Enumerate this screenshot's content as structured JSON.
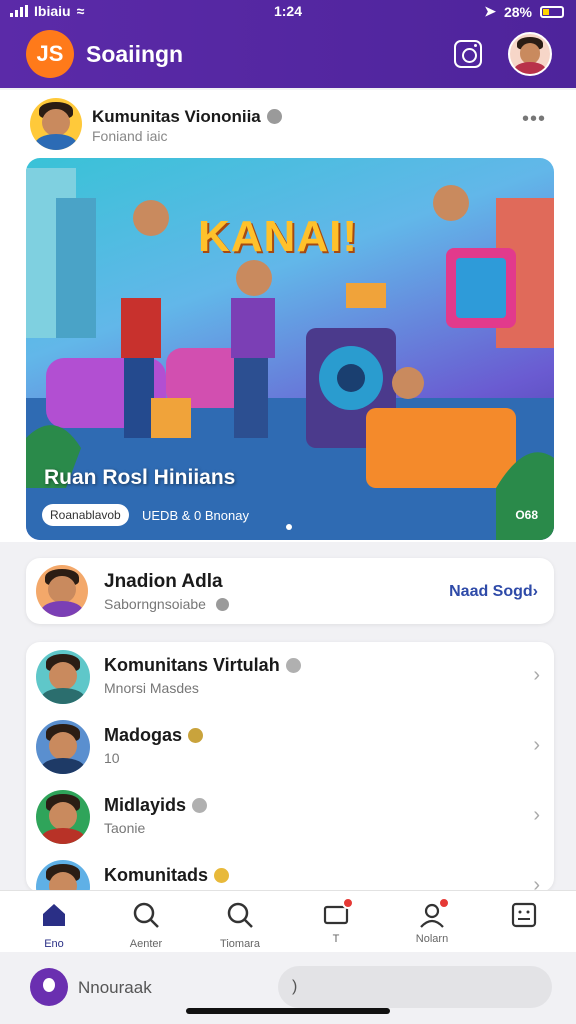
{
  "status_bar": {
    "carrier": "Ibiaiu",
    "time": "1:24",
    "battery": "28%"
  },
  "header": {
    "logo_text": "JS",
    "title": "Soaiingn"
  },
  "post": {
    "author": "Kumunitas Viononiia",
    "subtitle": "Foniand iaic",
    "banner": {
      "headline": "KANAI!",
      "title": "Ruan Rosl Hiniians",
      "chip": "Roanablavob",
      "meta": "UEDB & 0 Bnonay",
      "count": "O68"
    }
  },
  "friend": {
    "name": "Jnadion Adla",
    "subtitle": "Saborngnsoiabe",
    "link": "Naad Sogd"
  },
  "communities": [
    {
      "title": "Komunitans Virtulah",
      "subtitle": "Mnorsi Masdes",
      "avatar_bg": "#5fc7c9",
      "shirt": "#2b6e6e"
    },
    {
      "title": "Madogas",
      "subtitle": "10",
      "avatar_bg": "#5a8fcf",
      "shirt": "#1e3a66"
    },
    {
      "title": "Midlayids",
      "subtitle": "Taonie",
      "avatar_bg": "#2fa45a",
      "shirt": "#b83227"
    },
    {
      "title": "Komunitads",
      "subtitle": "",
      "avatar_bg": "#5fb0e6",
      "shirt": "#c94c2e"
    }
  ],
  "nav": [
    {
      "label": "Eno",
      "icon": "home-icon",
      "active": true
    },
    {
      "label": "Aenter",
      "icon": "search-icon"
    },
    {
      "label": "Tiomara",
      "icon": "search-icon"
    },
    {
      "label": "T",
      "icon": "message-icon"
    },
    {
      "label": "Nolarn",
      "icon": "profile-icon"
    },
    {
      "label": "",
      "icon": "menu-icon"
    }
  ],
  "composer": {
    "name": "Nnouraak",
    "input": ")"
  },
  "colors": {
    "brand_purple": "#5b2aa8",
    "link_blue": "#2e4aa8",
    "badge_red": "#e53935",
    "logo_orange": "#ff7a1a"
  }
}
